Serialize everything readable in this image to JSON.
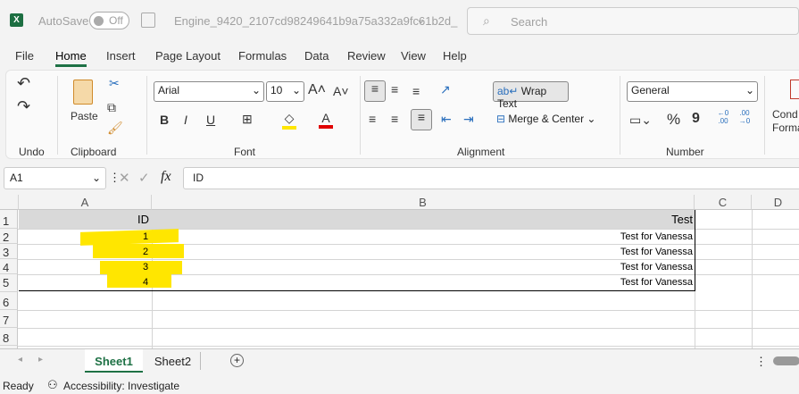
{
  "titlebar": {
    "autosave_label": "AutoSave",
    "autosave_state": "Off",
    "filename": "Engine_9420_2107cd98249641b9a75a332a9fc61b2d_",
    "search_placeholder": "Search"
  },
  "menu": [
    "File",
    "Home",
    "Insert",
    "Page Layout",
    "Formulas",
    "Data",
    "Review",
    "View",
    "Help"
  ],
  "ribbon": {
    "groups": {
      "undo": "Undo",
      "clipboard": "Clipboard",
      "font": "Font",
      "alignment": "Alignment",
      "number": "Number"
    },
    "paste": "Paste",
    "font_name": "Arial",
    "font_size": "10",
    "bold": "B",
    "italic": "I",
    "underline": "U",
    "wrap_text": "Wrap Text",
    "merge_center": "Merge & Center",
    "number_format": "General",
    "percent": "%",
    "comma": "9",
    "inc_decimal": "←0 .00",
    "dec_decimal": ".00 →0",
    "cond_format": "Cond Forma",
    "font_color": "#e00000",
    "fill_color": "#ffe600"
  },
  "formula_bar": {
    "name_box": "A1",
    "fx": "fx",
    "value": "ID"
  },
  "columns": [
    "A",
    "B",
    "C",
    "D"
  ],
  "rows": [
    "1",
    "2",
    "3",
    "4",
    "5",
    "6",
    "7",
    "8"
  ],
  "table": {
    "header": [
      "ID",
      "Test"
    ],
    "data": [
      [
        "1",
        "Test for Vanessa"
      ],
      [
        "2",
        "Test for Vanessa"
      ],
      [
        "3",
        "Test for Vanessa"
      ],
      [
        "4",
        "Test for Vanessa"
      ]
    ]
  },
  "sheets": [
    "Sheet1",
    "Sheet2"
  ],
  "status": {
    "ready": "Ready",
    "accessibility": "Accessibility: Investigate"
  }
}
